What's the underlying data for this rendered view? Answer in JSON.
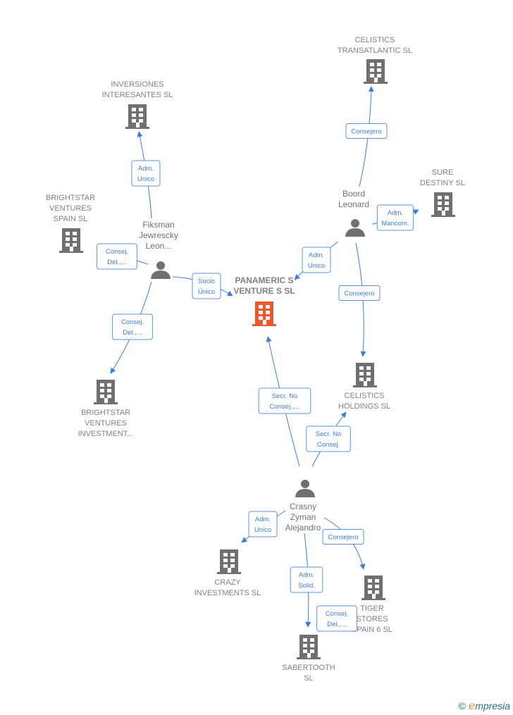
{
  "colors": {
    "main_company": "#f0582a",
    "company": "#707070",
    "person": "#707070",
    "edge": "#3b7dd8"
  },
  "nodes": [
    {
      "id": "panamerics",
      "type": "company",
      "main": true,
      "icon": "building-icon",
      "label": [
        "PANAMERIC S",
        "VENTURE S SL"
      ]
    },
    {
      "id": "cel_trans",
      "type": "company",
      "icon": "building-icon",
      "label": [
        "CELISTICS",
        "TRANSATLANTIC SL"
      ]
    },
    {
      "id": "inversiones",
      "type": "company",
      "icon": "building-icon",
      "label": [
        "INVERSIONES",
        "INTERESANTES SL"
      ]
    },
    {
      "id": "sure",
      "type": "company",
      "icon": "building-icon",
      "label": [
        "SURE",
        "DESTINY SL"
      ]
    },
    {
      "id": "bs_spain",
      "type": "company",
      "icon": "building-icon",
      "label": [
        "BRIGHTSTAR",
        "VENTURES",
        "SPAIN  SL"
      ]
    },
    {
      "id": "cel_hold",
      "type": "company",
      "icon": "building-icon",
      "label": [
        "CELISTICS",
        "HOLDINGS SL"
      ]
    },
    {
      "id": "bs_inv",
      "type": "company",
      "icon": "building-icon",
      "label": [
        "BRIGHTSTAR",
        "VENTURES",
        "INVESTMENT..."
      ]
    },
    {
      "id": "crazy",
      "type": "company",
      "icon": "building-icon",
      "label": [
        "CRAZY",
        "INVESTMENTS SL"
      ]
    },
    {
      "id": "tiger",
      "type": "company",
      "icon": "building-icon",
      "label": [
        "TIGER",
        "STORES",
        "SPAIN 6  SL"
      ]
    },
    {
      "id": "saber",
      "type": "company",
      "icon": "building-icon",
      "label": [
        "SABERTOOTH",
        "SL"
      ]
    },
    {
      "id": "boord",
      "type": "person",
      "icon": "person-icon",
      "label": [
        "Boord",
        "Leonard"
      ]
    },
    {
      "id": "fiksman",
      "type": "person",
      "icon": "person-icon",
      "label": [
        "Fiksman",
        "Jewrescky",
        "Leon..."
      ]
    },
    {
      "id": "crasny",
      "type": "person",
      "icon": "person-icon",
      "label": [
        "Crasny",
        "Zyman",
        "Alejandro"
      ]
    }
  ],
  "edges": [
    {
      "id": "e1",
      "from": "fiksman",
      "to": "inversiones",
      "label": [
        "Adm.",
        "Unico"
      ]
    },
    {
      "id": "e2",
      "from": "fiksman",
      "to": "bs_spain",
      "label": [
        "Consej.",
        "Del.,..."
      ]
    },
    {
      "id": "e3",
      "from": "fiksman",
      "to": "panamerics",
      "label": [
        "Socio",
        "Único"
      ]
    },
    {
      "id": "e4",
      "from": "fiksman",
      "to": "bs_inv",
      "label": [
        "Consej.",
        "Del.,..."
      ]
    },
    {
      "id": "e5",
      "from": "boord",
      "to": "cel_trans",
      "label": [
        "Consejero"
      ]
    },
    {
      "id": "e6",
      "from": "boord",
      "to": "sure",
      "label": [
        "Adm.",
        "Mancom."
      ]
    },
    {
      "id": "e7",
      "from": "boord",
      "to": "panamerics",
      "label": [
        "Adm.",
        "Unico"
      ]
    },
    {
      "id": "e8",
      "from": "boord",
      "to": "cel_hold",
      "label": [
        "Consejero"
      ]
    },
    {
      "id": "e9",
      "from": "crasny",
      "to": "panamerics",
      "label": [
        "Secr.  No",
        "Consej.,..."
      ]
    },
    {
      "id": "e10",
      "from": "crasny",
      "to": "cel_hold",
      "label": [
        "Secr.  No",
        "Consej."
      ]
    },
    {
      "id": "e11",
      "from": "crasny",
      "to": "crazy",
      "label": [
        "Adm.",
        "Unico"
      ]
    },
    {
      "id": "e12",
      "from": "crasny",
      "to": "saber",
      "label": [
        "Adm.",
        "Solid."
      ]
    },
    {
      "id": "e13",
      "from": "crasny",
      "to": "tiger",
      "label": [
        "Consejero"
      ]
    },
    {
      "id": "e14",
      "from": "crasny",
      "to": "tiger",
      "label": [
        "Consej.",
        "Del.,..."
      ]
    }
  ],
  "footer": {
    "copyright": "©",
    "brand_initial": "e",
    "brand_rest": "mpresia"
  }
}
